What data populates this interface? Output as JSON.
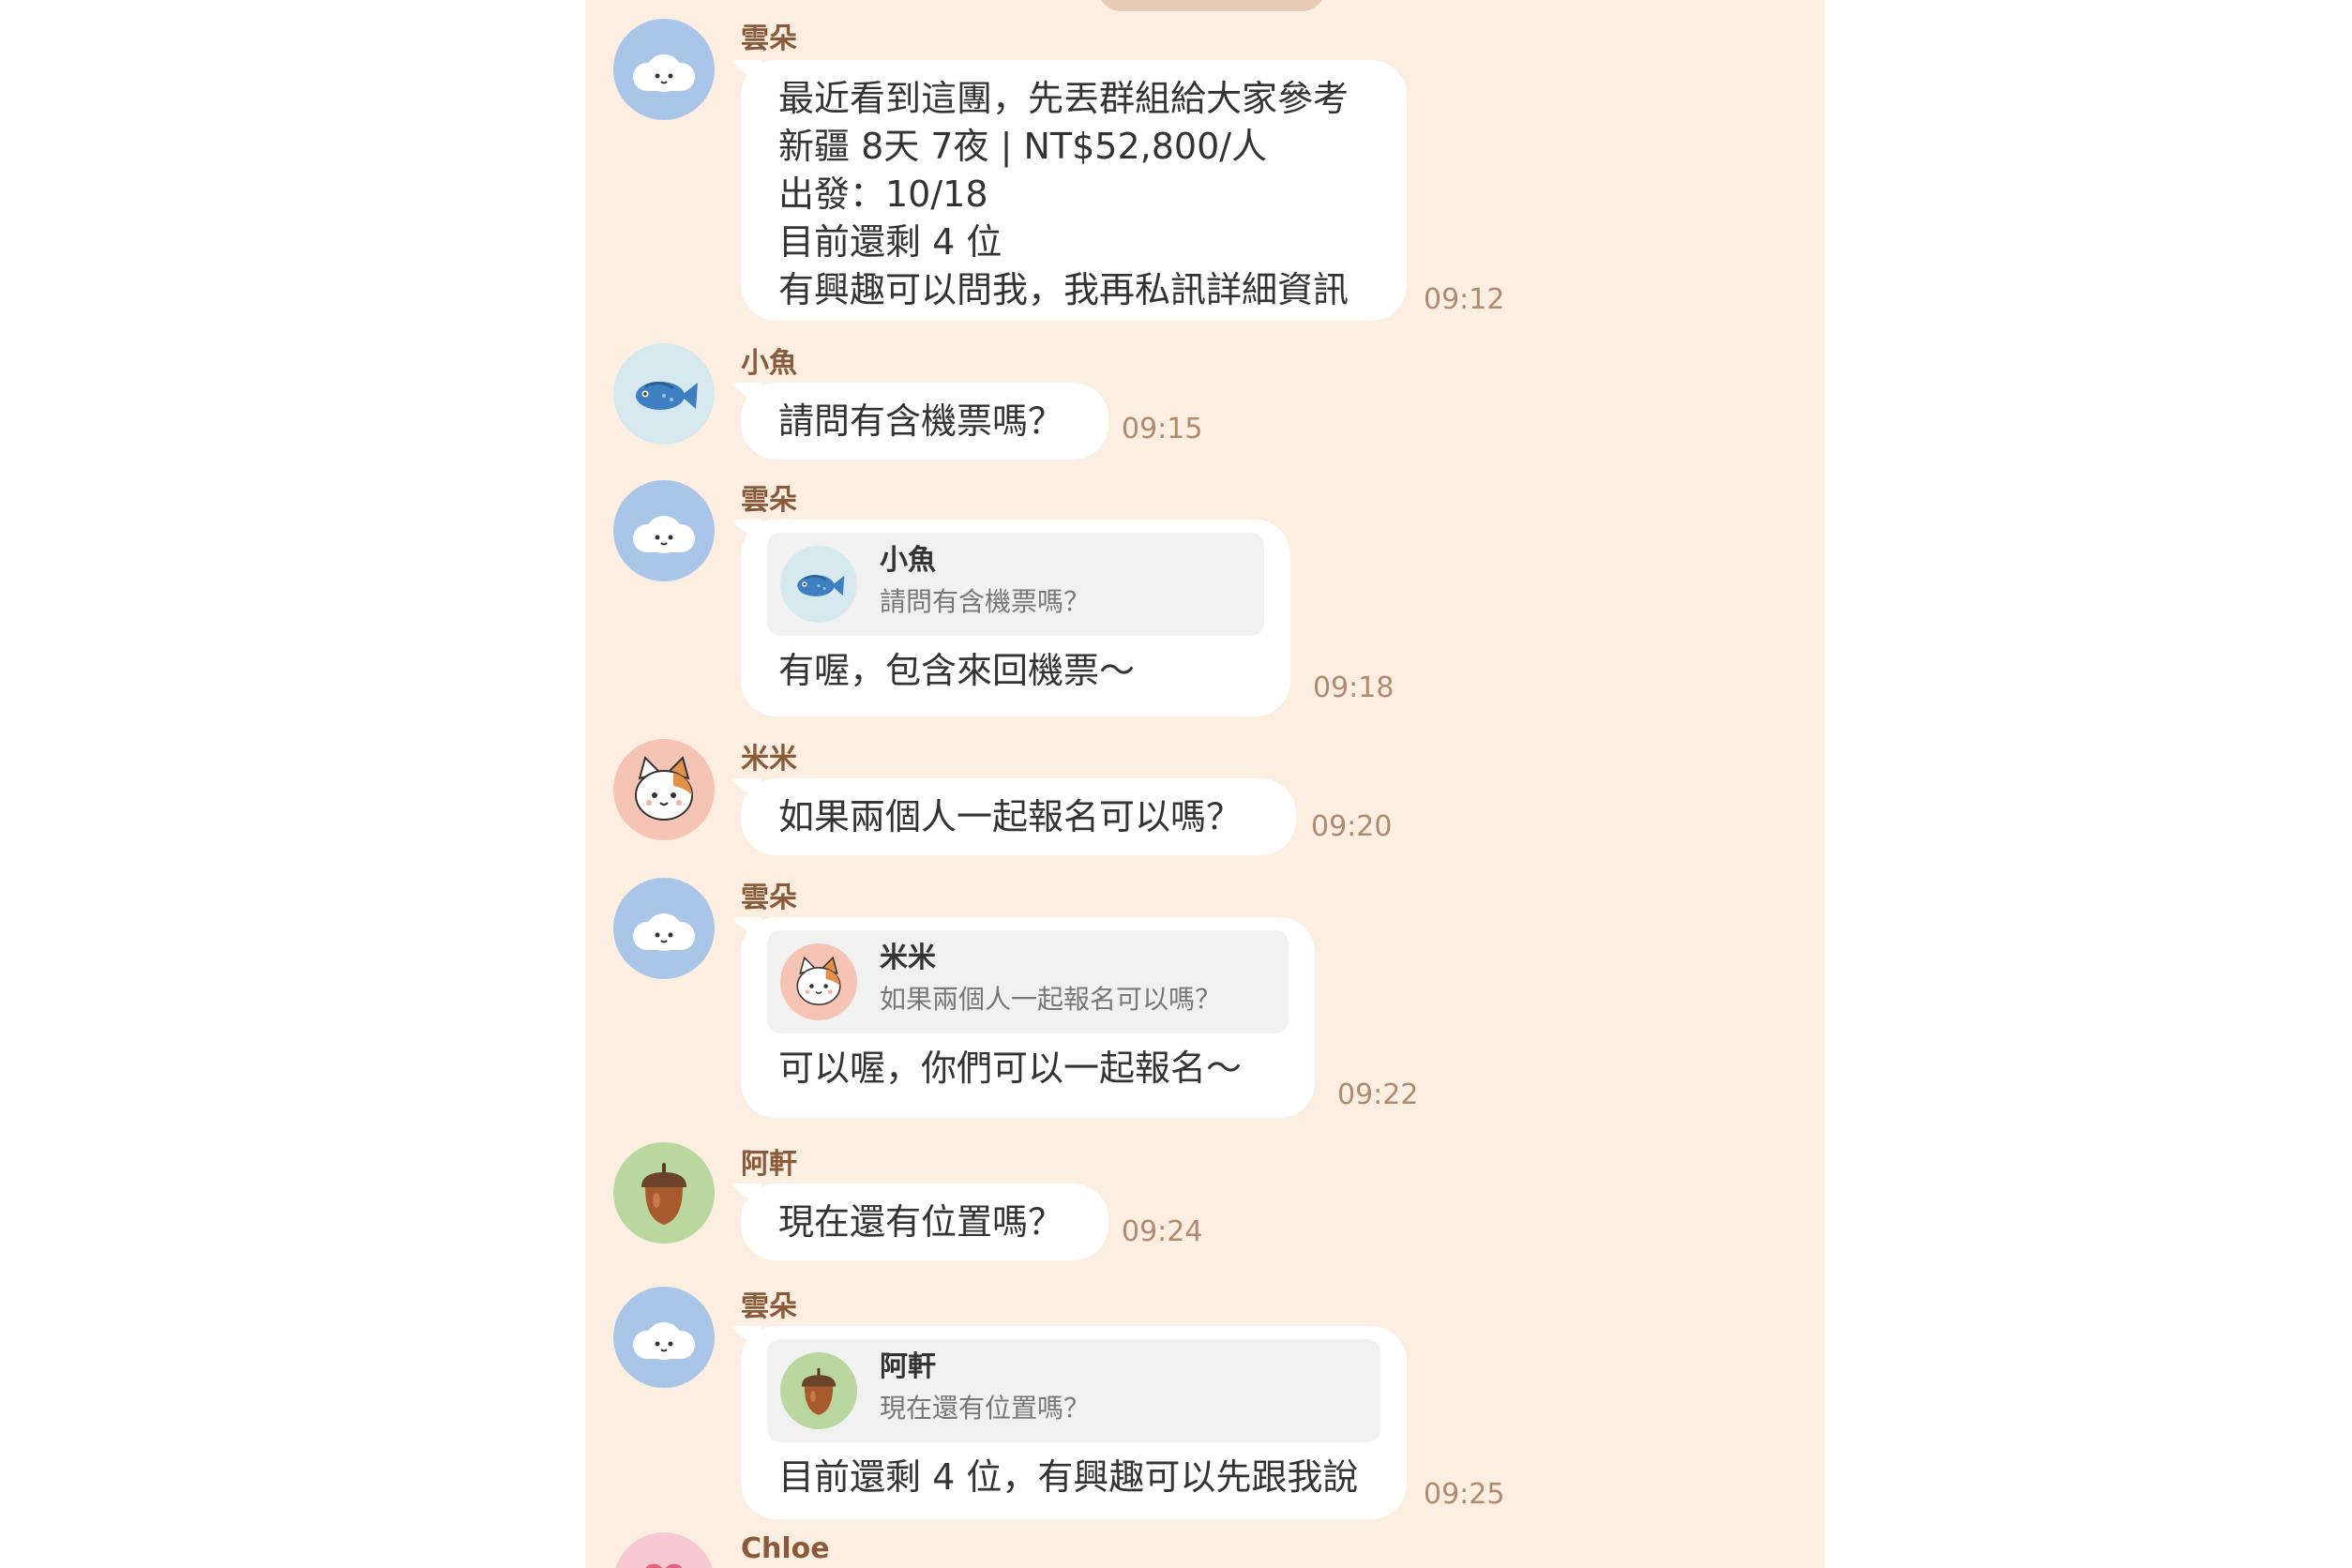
{
  "chat": {
    "messages": [
      {
        "sender": "雲朵",
        "avatar_icon": "cloud-icon",
        "lines": [
          "最近看到這團，先丟群組給大家參考",
          "新疆 8天 7夜 | NT$52,800/人",
          "出發：10/18",
          "目前還剩 4 位",
          "有興趣可以問我，我再私訊詳細資訊"
        ],
        "time": "09:12"
      },
      {
        "sender": "小魚",
        "avatar_icon": "fish-icon",
        "lines": [
          "請問有含機票嗎？"
        ],
        "time": "09:15"
      },
      {
        "sender": "雲朵",
        "avatar_icon": "cloud-icon",
        "reply": {
          "sender": "小魚",
          "avatar_icon": "fish-icon",
          "text": "請問有含機票嗎？"
        },
        "lines": [
          "有喔，包含來回機票～"
        ],
        "time": "09:18"
      },
      {
        "sender": "米米",
        "avatar_icon": "cat-icon",
        "lines": [
          "如果兩個人一起報名可以嗎？"
        ],
        "time": "09:20"
      },
      {
        "sender": "雲朵",
        "avatar_icon": "cloud-icon",
        "reply": {
          "sender": "米米",
          "avatar_icon": "cat-icon",
          "text": "如果兩個人一起報名可以嗎？"
        },
        "lines": [
          "可以喔，你們可以一起報名～"
        ],
        "time": "09:22"
      },
      {
        "sender": "阿軒",
        "avatar_icon": "acorn-icon",
        "lines": [
          "現在還有位置嗎？"
        ],
        "time": "09:24"
      },
      {
        "sender": "雲朵",
        "avatar_icon": "cloud-icon",
        "reply": {
          "sender": "阿軒",
          "avatar_icon": "acorn-icon",
          "text": "現在還有位置嗎？"
        },
        "lines": [
          "目前還剩 4 位，有興趣可以先跟我說"
        ],
        "time": "09:25"
      },
      {
        "sender": "Chloe",
        "avatar_icon": "heart-icon"
      }
    ]
  },
  "colors": {
    "chat_background": "#fcefe1",
    "bubble": "#ffffff",
    "sender_name": "#8a5a3a",
    "timestamp": "#b08a70",
    "quote_background": "#f1f1f1"
  }
}
